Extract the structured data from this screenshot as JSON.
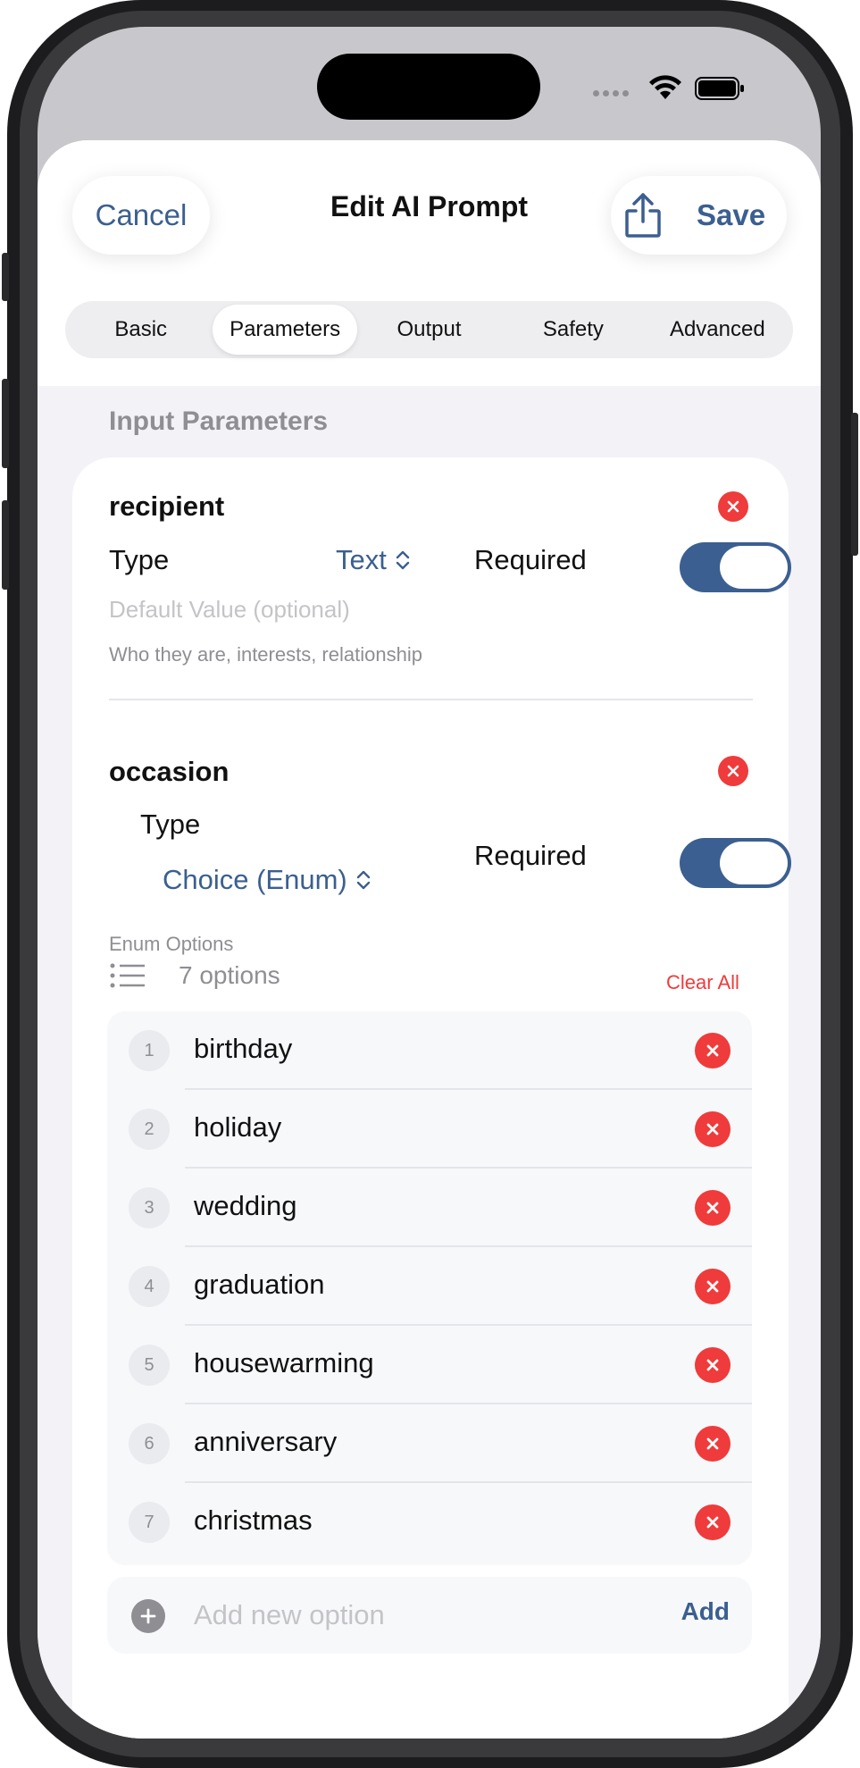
{
  "nav": {
    "cancel_label": "Cancel",
    "title": "Edit AI Prompt",
    "save_label": "Save",
    "share_icon": "share-icon"
  },
  "tabs": [
    {
      "label": "Basic",
      "active": false
    },
    {
      "label": "Parameters",
      "active": true
    },
    {
      "label": "Output",
      "active": false
    },
    {
      "label": "Safety",
      "active": false
    },
    {
      "label": "Advanced",
      "active": false
    }
  ],
  "section_header": "Input Parameters",
  "params": [
    {
      "name": "recipient",
      "type_label": "Type",
      "type_value": "Text",
      "required_label": "Required",
      "required": true,
      "default_placeholder": "Default Value (optional)",
      "hint": "Who they are, interests, relationship"
    },
    {
      "name": "occasion",
      "type_label": "Type",
      "type_value": "Choice (Enum)",
      "required_label": "Required",
      "required": true,
      "enum_label": "Enum Options",
      "options_count": "7 options",
      "clear_all_label": "Clear All",
      "options": [
        {
          "num": "1",
          "value": "birthday"
        },
        {
          "num": "2",
          "value": "holiday"
        },
        {
          "num": "3",
          "value": "wedding"
        },
        {
          "num": "4",
          "value": "graduation"
        },
        {
          "num": "5",
          "value": "housewarming"
        },
        {
          "num": "6",
          "value": "anniversary"
        },
        {
          "num": "7",
          "value": "christmas"
        }
      ],
      "add_placeholder": "Add new option",
      "add_label": "Add"
    }
  ],
  "colors": {
    "accent": "#3b5f90",
    "destructive": "#ef3b3b",
    "secondary_text": "#8e8e93",
    "background": "#f2f2f7"
  }
}
